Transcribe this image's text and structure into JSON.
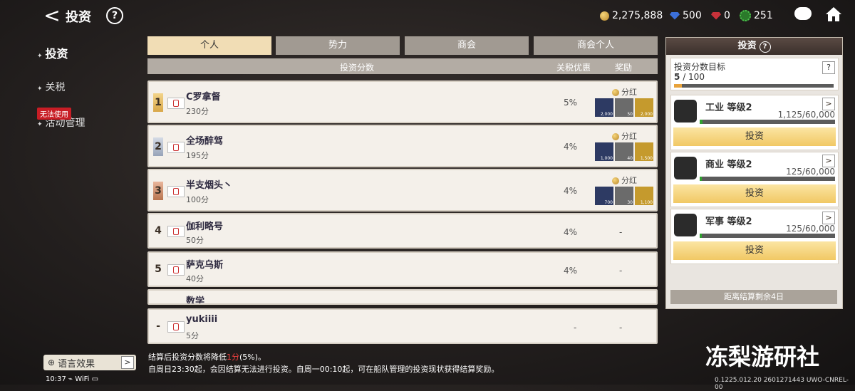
{
  "header": {
    "back": "<",
    "title": "投资",
    "help": "?"
  },
  "currency": {
    "gold": "2,275,888",
    "blue": "500",
    "red": "0",
    "green": "251"
  },
  "nav": {
    "invest": "投资",
    "tax": "关税",
    "event": "活动管理",
    "disabled_badge": "无法使用"
  },
  "tabs": [
    "个人",
    "势力",
    "商会",
    "商会个人"
  ],
  "columns": {
    "score": "投资分数",
    "tax": "关税优惠",
    "reward": "奖励"
  },
  "rows": [
    {
      "rank": "1",
      "name": "C罗拿督",
      "score": "230分",
      "tax": "5%",
      "bonus": "分红",
      "items": [
        "2,000",
        "50",
        "2,000"
      ]
    },
    {
      "rank": "2",
      "name": "全场醉驾",
      "score": "195分",
      "tax": "4%",
      "bonus": "分红",
      "items": [
        "1,000",
        "40",
        "1,500"
      ]
    },
    {
      "rank": "3",
      "name": "半支烟头丶",
      "score": "100分",
      "tax": "4%",
      "bonus": "分红",
      "items": [
        "700",
        "30",
        "1,100"
      ]
    },
    {
      "rank": "4",
      "name": "伽利略号",
      "score": "50分",
      "tax": "4%",
      "reward": "-"
    },
    {
      "rank": "5",
      "name": "萨克乌斯",
      "score": "40分",
      "tax": "4%",
      "reward": "-"
    },
    {
      "rank": "",
      "name": "数学"
    },
    {
      "rank": "-",
      "name": "yukiiii",
      "score": "5分",
      "tax": "-",
      "reward": "-"
    }
  ],
  "footer": {
    "line1_a": "结算后投资分数将降低",
    "line1_red": "1分",
    "line1_b": "(5%)。",
    "line2": "自周日23:30起，会因结算无法进行投资。自周一00:10起，可在船队管理的投资现状获得结算奖励。"
  },
  "panel": {
    "title": "投资",
    "help": "?",
    "goal_label": "投资分数目标",
    "goal_current": "5",
    "goal_total": "/ 100",
    "goal_progress": 0.05,
    "sectors": [
      {
        "name": "工业 等级2",
        "value": "1,125/60,000",
        "button": "投资",
        "progress": 0.02
      },
      {
        "name": "商业 等级2",
        "value": "125/60,000",
        "button": "投资",
        "progress": 0.002
      },
      {
        "name": "军事 等级2",
        "value": "125/60,000",
        "button": "投资",
        "progress": 0.002
      }
    ],
    "countdown": "距离结算剩余4日"
  },
  "lang_btn": "语言效果",
  "status": "10:37 ⌁ WiFi ▭",
  "watermark": "冻梨游研社",
  "version": "0.1225.012.20 2601271443 UWO-CNREL-00",
  "colors": {
    "tab_active": "#f1ddb5",
    "button": "#f1c864",
    "progress_green": "#2fa12f"
  }
}
